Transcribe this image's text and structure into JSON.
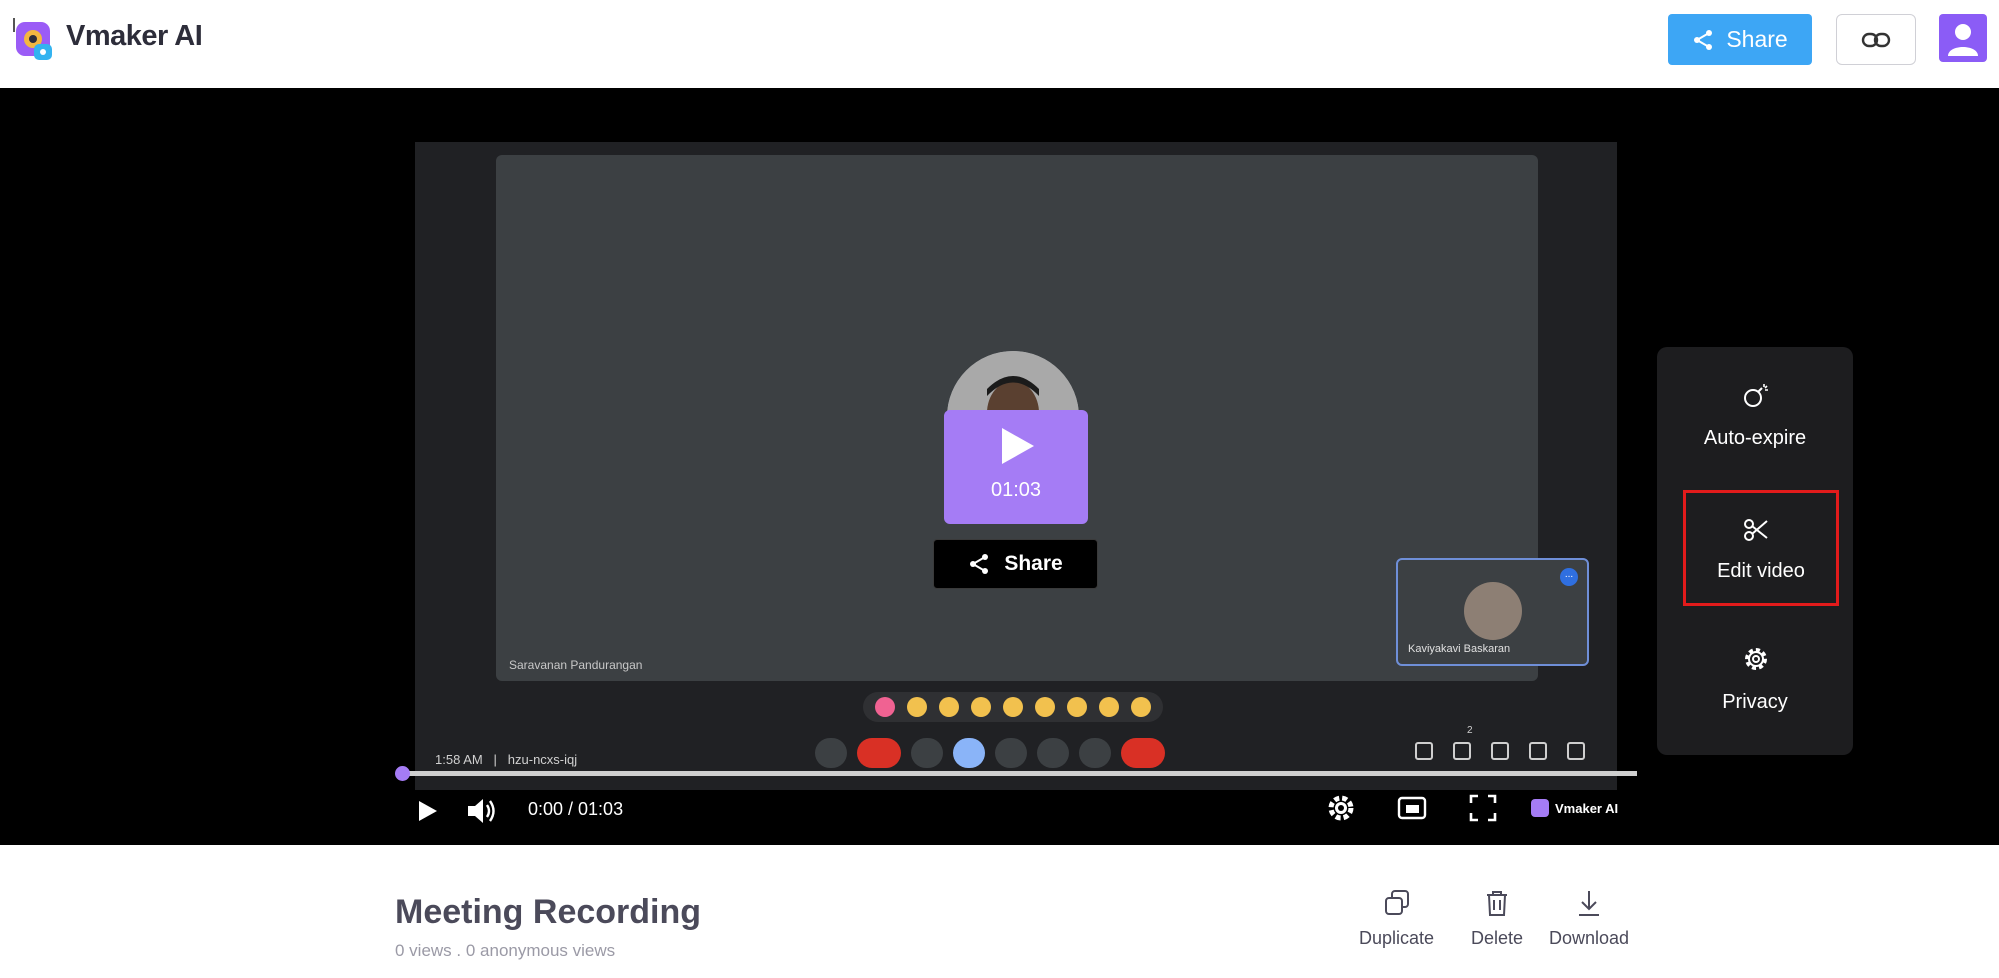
{
  "header": {
    "brand": "Vmaker AI",
    "share_label": "Share",
    "icons": {
      "logo": "vmaker-logo-icon",
      "share": "share-icon",
      "link": "link-icon",
      "avatar": "user-avatar-icon"
    }
  },
  "video": {
    "meeting": {
      "speaker_name": "Saravanan Pandurangan",
      "pip_name": "Kaviyakavi Baskaran",
      "pip_menu": "...",
      "time": "1:58 AM",
      "code": "hzu-ncxs-iqj",
      "participants_count": "2"
    },
    "overlay": {
      "duration": "01:03",
      "share_label": "Share"
    },
    "player": {
      "time_display": "0:00 / 01:03",
      "progress_percent": 0,
      "watermark": "Vmaker AI"
    }
  },
  "side_panel": {
    "items": [
      {
        "label": "Auto-expire",
        "icon": "timer-bomb-icon"
      },
      {
        "label": "Edit video",
        "icon": "scissors-icon",
        "highlighted": true
      },
      {
        "label": "Privacy",
        "icon": "gear-icon"
      }
    ],
    "highlight_color": "#e21b1b"
  },
  "details": {
    "title": "Meeting Recording",
    "views": "0 views . 0 anonymous views",
    "actions": [
      {
        "label": "Duplicate",
        "icon": "duplicate-icon"
      },
      {
        "label": "Delete",
        "icon": "trash-icon"
      },
      {
        "label": "Download",
        "icon": "download-icon"
      }
    ]
  },
  "colors": {
    "accent": "#a57cf5",
    "share_blue": "#3da6f5",
    "brand_purple": "#8b5cf6"
  }
}
